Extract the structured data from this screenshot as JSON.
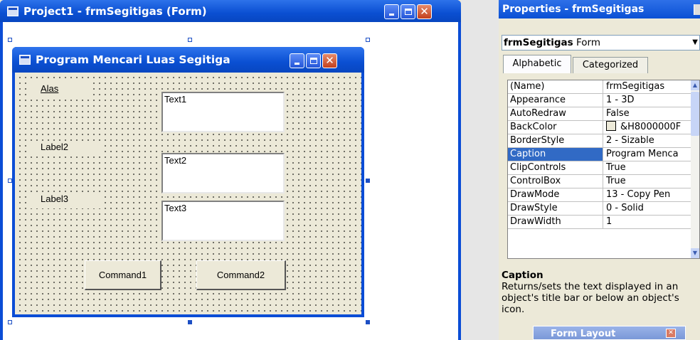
{
  "designer": {
    "title": "Project1 - frmSegitigas (Form)",
    "form": {
      "title": "Program Mencari Luas Segitiga",
      "labels": [
        "Alas",
        "Label2",
        "Label3"
      ],
      "textboxes": [
        "Text1",
        "Text2",
        "Text3"
      ],
      "buttons": [
        "Command1",
        "Command2"
      ]
    }
  },
  "properties": {
    "title": "Properties - frmSegitigas",
    "object_name": "frmSegitigas",
    "object_type": "Form",
    "tabs": [
      "Alphabetic",
      "Categorized"
    ],
    "rows": [
      {
        "name": "(Name)",
        "value": "frmSegitigas"
      },
      {
        "name": "Appearance",
        "value": "1 - 3D"
      },
      {
        "name": "AutoRedraw",
        "value": "False"
      },
      {
        "name": "BackColor",
        "value": "&H8000000F"
      },
      {
        "name": "BorderStyle",
        "value": "2 - Sizable"
      },
      {
        "name": "Caption",
        "value": "Program Menca",
        "selected": true
      },
      {
        "name": "ClipControls",
        "value": "True"
      },
      {
        "name": "ControlBox",
        "value": "True"
      },
      {
        "name": "DrawMode",
        "value": "13 - Copy Pen"
      },
      {
        "name": "DrawStyle",
        "value": "0 - Solid"
      },
      {
        "name": "DrawWidth",
        "value": "1"
      }
    ],
    "description_title": "Caption",
    "description_text": "Returns/sets the text displayed in an object's title bar or below an object's icon."
  },
  "form_layout": {
    "title": "Form Layout"
  },
  "colors": {
    "xp_blue": "#0a52d6",
    "selection": "#316ac5",
    "face": "#ece9d8"
  }
}
